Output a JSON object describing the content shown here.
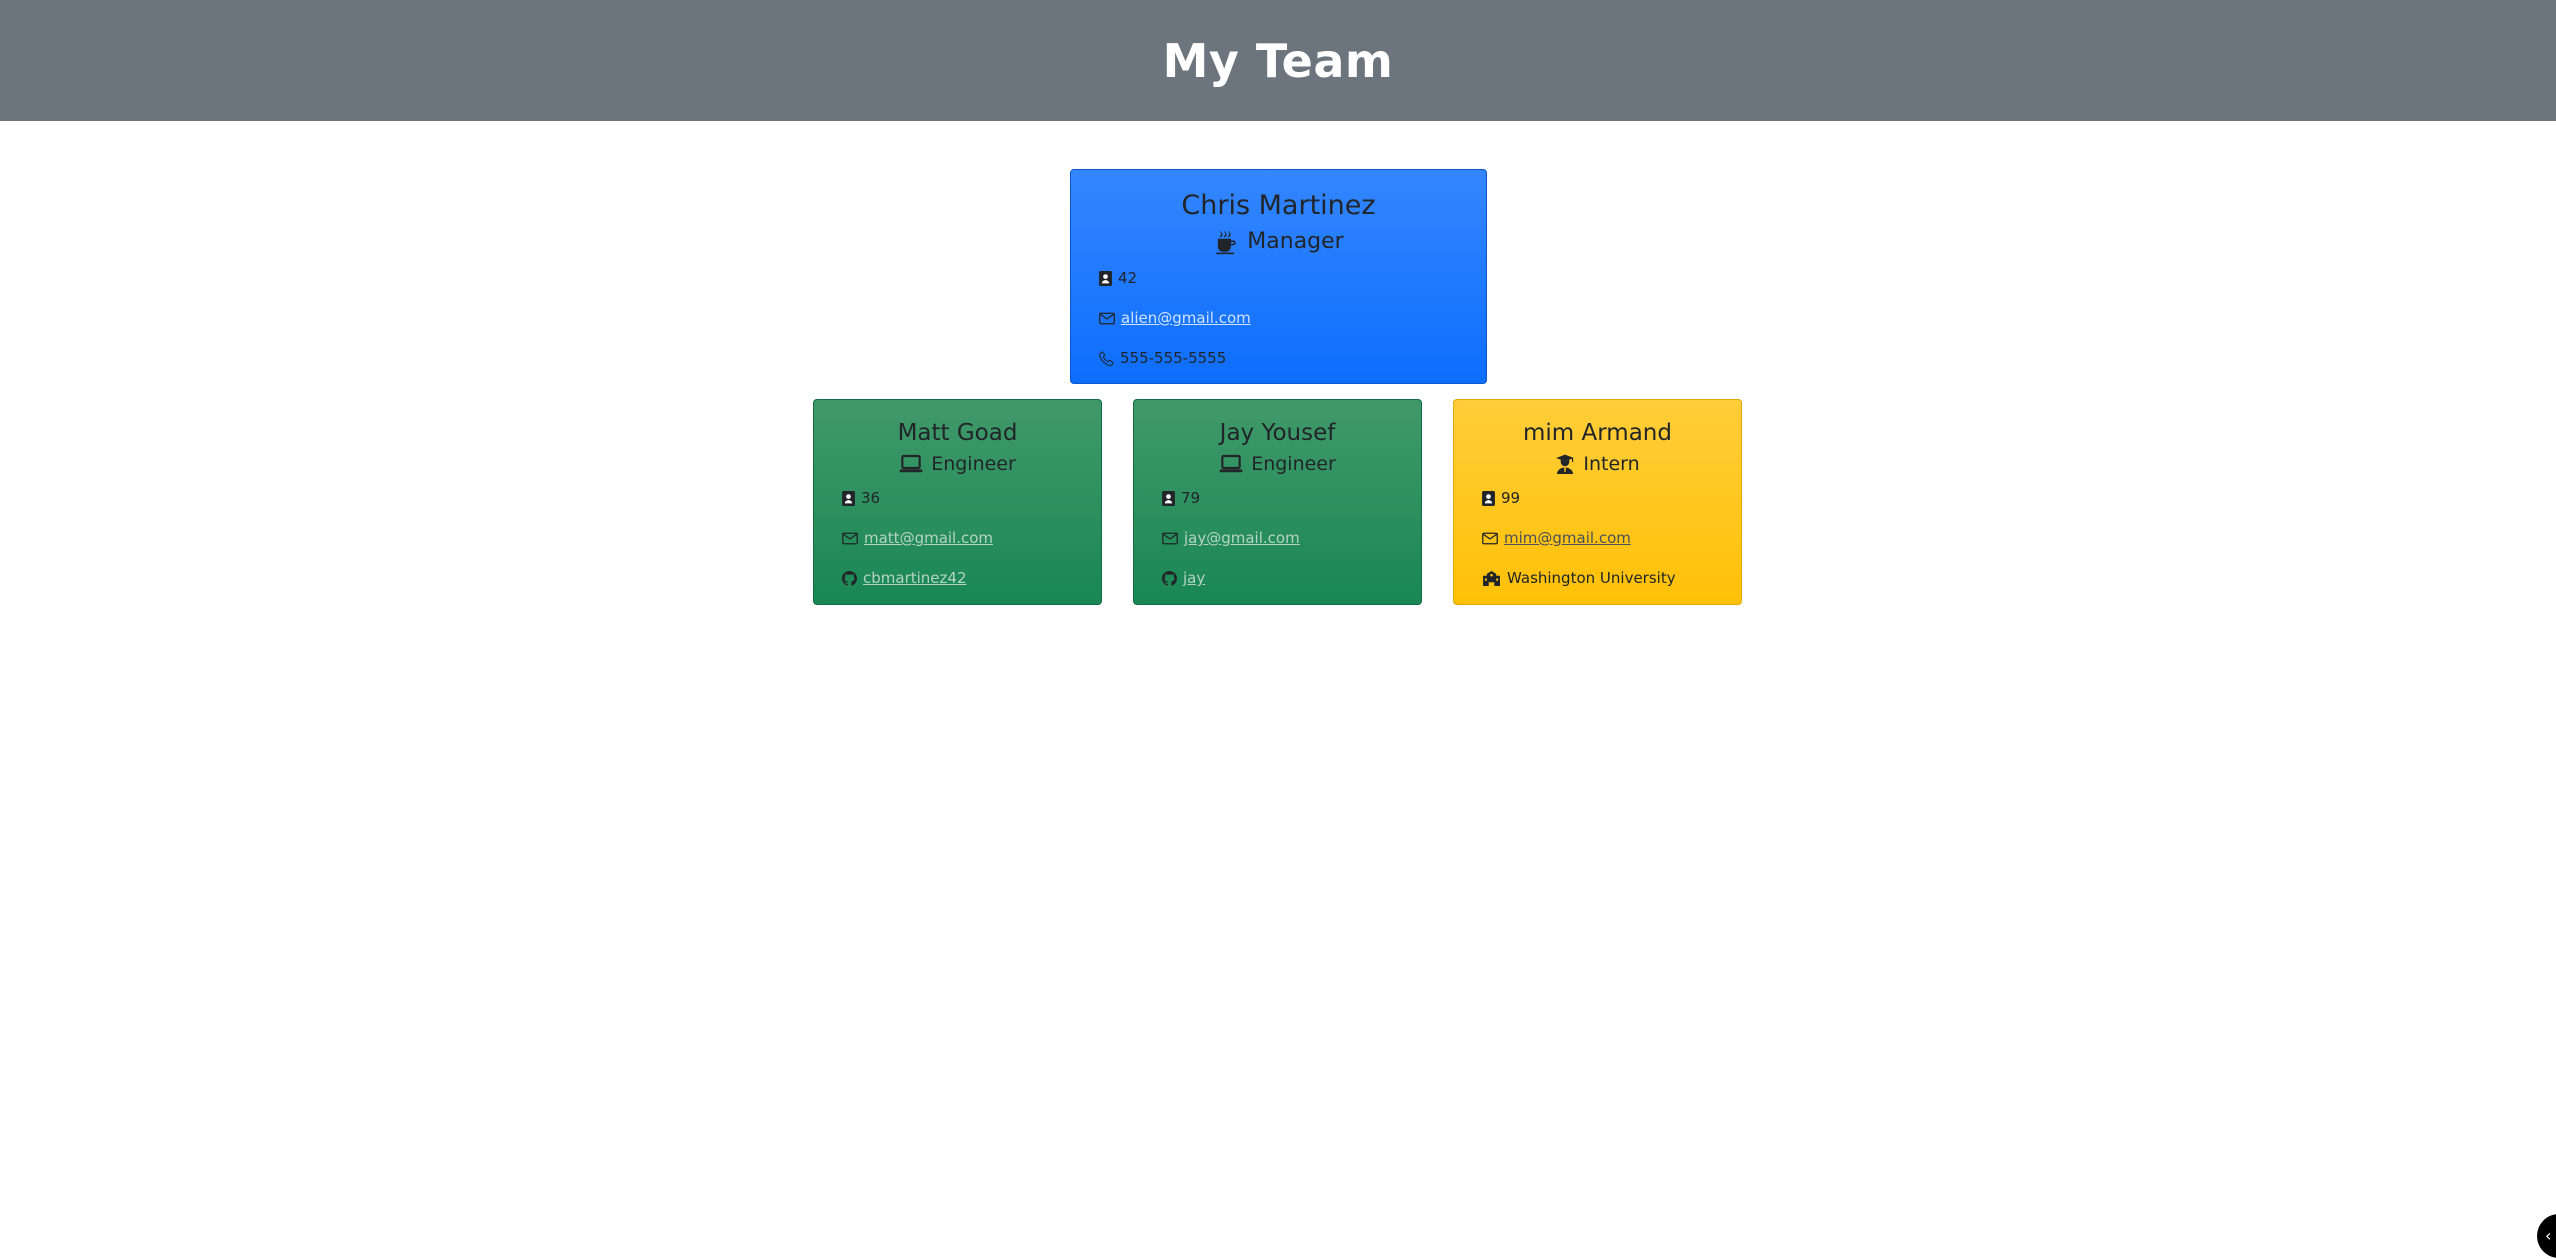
{
  "header": {
    "title": "My Team"
  },
  "manager": {
    "name": "Chris Martinez",
    "role": "Manager",
    "id": "42",
    "email": "alien@gmail.com",
    "phone": "555-555-5555"
  },
  "engineers": [
    {
      "name": "Matt Goad",
      "role": "Engineer",
      "id": "36",
      "email": "matt@gmail.com",
      "github": "cbmartinez42"
    },
    {
      "name": "Jay Yousef",
      "role": "Engineer",
      "id": "79",
      "email": "jay@gmail.com",
      "github": "jay"
    }
  ],
  "intern": {
    "name": "mim Armand",
    "role": "Intern",
    "id": "99",
    "email": "mim@gmail.com",
    "school": "Washington University"
  },
  "colors": {
    "header": "#6c757d",
    "manager": "#0d6efd",
    "engineer": "#198754",
    "intern": "#ffc107"
  },
  "icons": {
    "manager_role": "coffee-cup-icon",
    "engineer_role": "laptop-icon",
    "intern_role": "student-icon",
    "id": "badge-icon",
    "email": "envelope-icon",
    "phone": "phone-icon",
    "github": "github-icon",
    "school": "school-building-icon"
  }
}
